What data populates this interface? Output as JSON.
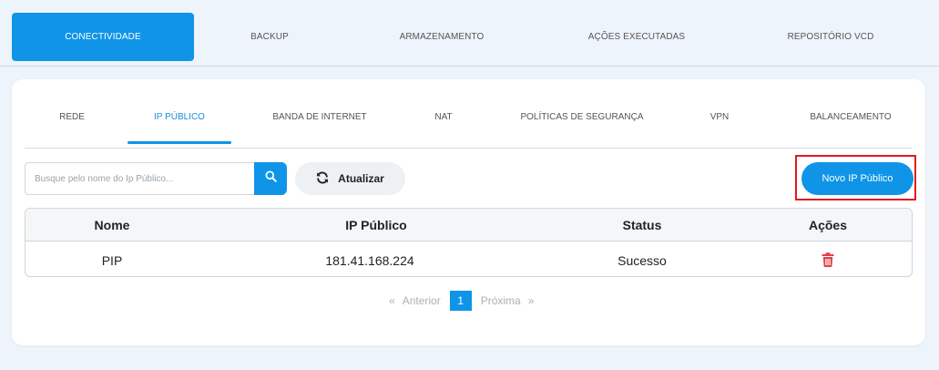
{
  "top_tabs": [
    {
      "label": "CONECTIVIDADE",
      "active": true
    },
    {
      "label": "BACKUP",
      "active": false
    },
    {
      "label": "ARMAZENAMENTO",
      "active": false
    },
    {
      "label": "AÇÕES EXECUTADAS",
      "active": false
    },
    {
      "label": "REPOSITÓRIO VCD",
      "active": false
    }
  ],
  "sub_tabs": [
    {
      "label": "REDE",
      "active": false
    },
    {
      "label": "IP PÚBLICO",
      "active": true
    },
    {
      "label": "BANDA DE INTERNET",
      "active": false
    },
    {
      "label": "NAT",
      "active": false
    },
    {
      "label": "POLÍTICAS DE SEGURANÇA",
      "active": false
    },
    {
      "label": "VPN",
      "active": false
    },
    {
      "label": "BALANCEAMENTO",
      "active": false
    }
  ],
  "search": {
    "placeholder": "Busque pelo nome do Ip Público...",
    "value": "",
    "icon": "search-icon"
  },
  "refresh": {
    "label": "Atualizar",
    "icon": "refresh-icon"
  },
  "new_button": {
    "label": "Novo IP Público"
  },
  "table": {
    "headers": [
      "Nome",
      "IP Público",
      "Status",
      "Ações"
    ],
    "rows": [
      {
        "nome": "PIP",
        "ip": "181.41.168.224",
        "status": "Sucesso",
        "action_icon": "trash-icon"
      }
    ]
  },
  "pagination": {
    "prev_arrow": "«",
    "prev": "Anterior",
    "current": "1",
    "next": "Próxima",
    "next_arrow": "»"
  },
  "colors": {
    "accent": "#0f94e8",
    "danger": "#e0414a",
    "highlight_border": "#e01b1b"
  }
}
